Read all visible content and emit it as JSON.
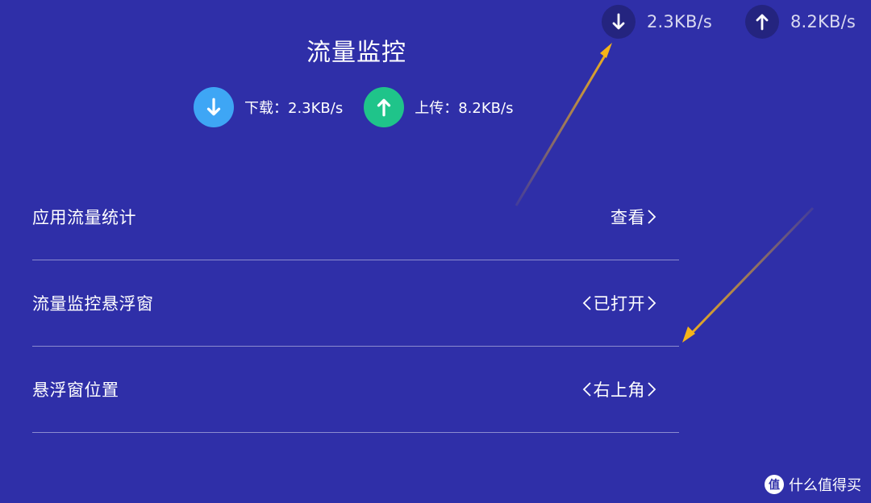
{
  "overlay": {
    "download_speed": "2.3KB/s",
    "upload_speed": "8.2KB/s"
  },
  "header": {
    "title": "流量监控"
  },
  "stats": {
    "download": "下载：2.3KB/s",
    "upload": "上传：8.2KB/s"
  },
  "settings": [
    {
      "label": "应用流量统计",
      "value": "查看"
    },
    {
      "label": "流量监控悬浮窗",
      "value": "已打开"
    },
    {
      "label": "悬浮窗位置",
      "value": "右上角"
    }
  ],
  "watermark": {
    "text": "什么值得买",
    "logo_char": "值"
  },
  "colors": {
    "background": "#2f2fa8",
    "download_icon": "#3ea6f5",
    "upload_icon": "#1fc48a",
    "annotation_arrow": "#f5b419"
  },
  "icons": {
    "download": "download-arrow-icon",
    "upload": "upload-arrow-icon"
  }
}
